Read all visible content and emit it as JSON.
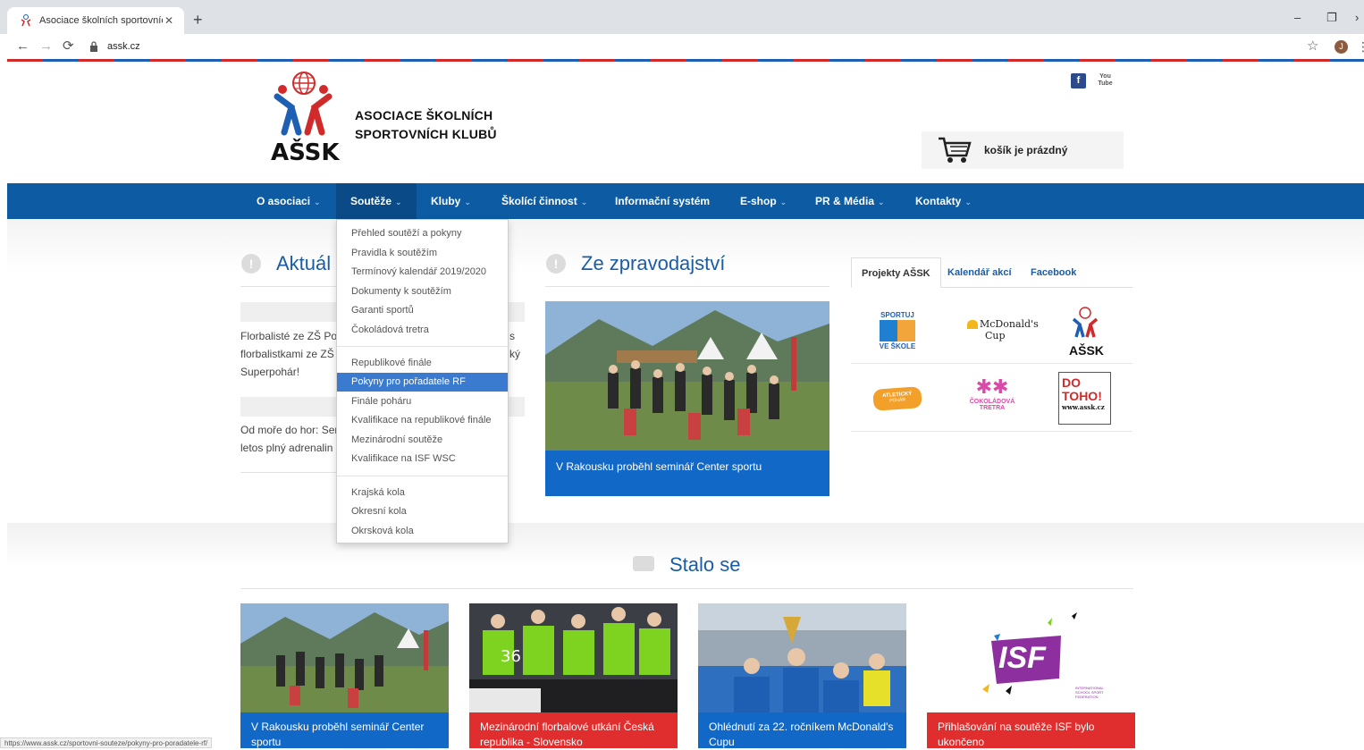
{
  "browser": {
    "tab_title": "Asociace školních sportovních kl",
    "new_tab": "+",
    "address": "assk.cz",
    "status_url": "https://www.assk.cz/sportovni-souteze/pokyny-pro-poradatele-rf/",
    "avatar_letter": "J"
  },
  "header": {
    "logo_text": "AŠSK",
    "org_line1": "ASOCIACE ŠKOLNÍCH",
    "org_line2": "SPORTOVNÍCH KLUBŮ",
    "cart_label": "košík je prázdný",
    "youtube_label": "You Tube"
  },
  "nav": {
    "items": [
      {
        "label": "O asociaci"
      },
      {
        "label": "Soutěže"
      },
      {
        "label": "Kluby"
      },
      {
        "label": "Školící činnost"
      },
      {
        "label": "Informační systém"
      },
      {
        "label": "E-shop"
      },
      {
        "label": "PR & Média"
      },
      {
        "label": "Kontakty"
      }
    ],
    "caret": "⌄"
  },
  "dropdown": {
    "items": [
      "Přehled soutěží a pokyny",
      "Pravidla k soutěžím",
      "Termínový kalendář 2019/2020",
      "Dokumenty k soutěžím",
      "Garanti sportů",
      "Čokoládová tretra",
      "Republikové finále",
      "Pokyny pro pořadatele RF",
      "Finále poháru",
      "Kvalifikace na republikové finále",
      "Mezinárodní soutěže",
      "Kvalifikace na ISF WSC",
      "Krajská kola",
      "Okresní kola",
      "Okrsková kola"
    ]
  },
  "aktuality": {
    "title": "Aktuál",
    "news1": [
      "Florbalisté ze ZŠ Po",
      "florbalistkami ze ZŠ",
      "Superpohár!"
    ],
    "news1_right": [
      "s",
      "ký"
    ],
    "news2": [
      "Od moře do hor: Ser",
      "letos plný adrenalin"
    ]
  },
  "zpravodajstvi": {
    "title": "Ze zpravodajství",
    "caption": "V Rakousku proběhl seminář Center sportu"
  },
  "projekty": {
    "tabs": [
      "Projekty AŠSK",
      "Kalendář akcí",
      "Facebook"
    ],
    "logos": {
      "sportuj": [
        "SPORTUJ",
        "VE ŠKOLE"
      ],
      "mcdonalds": [
        "McDonald's",
        "Cup"
      ],
      "assk": "AŠSK",
      "atleticky": [
        "ATLETICKÝ",
        "POHÁR"
      ],
      "tretra": [
        "ČOKOLÁDOVÁ",
        "TRETRA"
      ],
      "dotoho": [
        "DO",
        "TOHO!",
        "www.assk.cz"
      ]
    }
  },
  "stalo_se": {
    "title": "Stalo se",
    "cards": [
      {
        "caption": "V Rakousku proběhl seminář Center sportu"
      },
      {
        "caption": "Mezinárodní florbalové utkání Česká republika - Slovensko"
      },
      {
        "caption": "Ohlédnutí za 22. ročníkem McDonald's Cupu"
      },
      {
        "caption": "Přihlašování na soutěže ISF bylo ukončeno"
      }
    ],
    "isf_text": "ISF",
    "isf_sub": "INTERNATIONAL SCHOOL SPORT FEDERATION"
  },
  "colors": {
    "nav_blue": "#0c5ba3",
    "title_blue": "#1a5ca6",
    "caption_blue": "#1168c7",
    "caption_red": "#e02d2d",
    "highlight": "#3a7bd0"
  }
}
